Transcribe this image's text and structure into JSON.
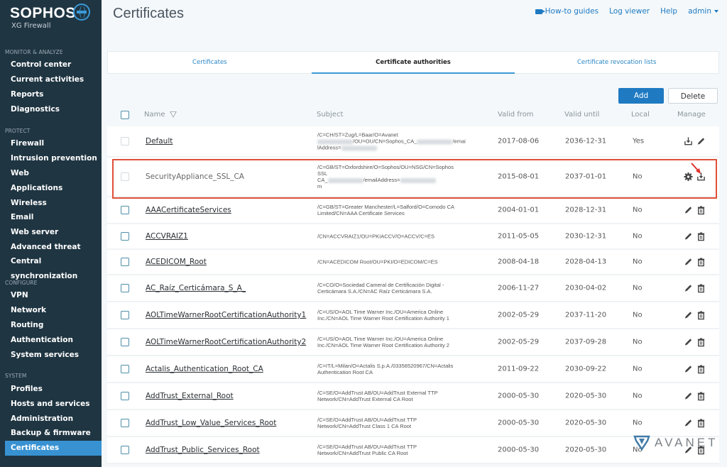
{
  "brand": {
    "name": "SOPHOS",
    "product": "XG Firewall"
  },
  "header": {
    "title": "Certificates"
  },
  "toplinks": {
    "howto": "How-to guides",
    "log": "Log viewer",
    "help": "Help",
    "user": "admin"
  },
  "sidebar": {
    "sections": [
      {
        "label": "MONITOR & ANALYZE",
        "items": [
          "Control center",
          "Current activities",
          "Reports",
          "Diagnostics"
        ]
      },
      {
        "label": "PROTECT",
        "items": [
          "Firewall",
          "Intrusion prevention",
          "Web",
          "Applications",
          "Wireless",
          "Email",
          "Web server",
          "Advanced threat",
          "Central synchronization"
        ]
      },
      {
        "label": "CONFIGURE",
        "items": [
          "VPN",
          "Network",
          "Routing",
          "Authentication",
          "System services"
        ]
      },
      {
        "label": "SYSTEM",
        "items": [
          "Profiles",
          "Hosts and services",
          "Administration",
          "Backup & firmware",
          "Certificates"
        ]
      }
    ],
    "active": "Certificates"
  },
  "tabs": [
    {
      "label": "Certificates",
      "active": false
    },
    {
      "label": "Certificate authorities",
      "active": true
    },
    {
      "label": "Certificate revocation lists",
      "active": false
    }
  ],
  "toolbar": {
    "add_label": "Add",
    "delete_label": "Delete"
  },
  "table": {
    "columns": {
      "name": "Name",
      "subject": "Subject",
      "valid_from": "Valid from",
      "valid_until": "Valid until",
      "local": "Local",
      "manage": "Manage"
    },
    "rows": [
      {
        "name": "Default",
        "subject_lines": [
          "/C=CH/ST=Zug/L=Baar/O=Avanet",
          "[redacted]/OU=OU/CN=Sophos_CA_[redacted]/emai",
          "lAddress=[redacted]"
        ],
        "valid_from": "2017-08-06",
        "valid_until": "2036-12-31",
        "local": "Yes",
        "actions": [
          "download",
          "edit"
        ],
        "link": true,
        "checkbox_enabled": false
      },
      {
        "name": "SecurityAppliance_SSL_CA",
        "subject_lines": [
          "/C=GB/ST=Oxfordshire/O=Sophos/OU=NSG/CN=Sophos",
          "SSL",
          "CA_[redacted]/emailAddress=[redacted]",
          "m"
        ],
        "valid_from": "2015-08-01",
        "valid_until": "2037-01-01",
        "local": "No",
        "actions": [
          "settings",
          "download"
        ],
        "link": false,
        "checkbox_enabled": false,
        "highlighted": true
      },
      {
        "name": "AAACertificateServices",
        "subject_lines": [
          "/C=GB/ST=Greater Manchester/L=Salford/O=Comodo CA",
          "Limited/CN=AAA Certificate Services"
        ],
        "valid_from": "2004-01-01",
        "valid_until": "2028-12-31",
        "local": "No",
        "actions": [
          "edit",
          "delete"
        ],
        "link": true,
        "checkbox_enabled": true
      },
      {
        "name": "ACCVRAIZ1",
        "subject_lines": [
          "/CN=ACCVRAIZ1/OU=PKIACCV/O=ACCV/C=ES"
        ],
        "valid_from": "2011-05-05",
        "valid_until": "2030-12-31",
        "local": "No",
        "actions": [
          "edit",
          "delete"
        ],
        "link": true,
        "checkbox_enabled": true
      },
      {
        "name": "ACEDICOM_Root",
        "subject_lines": [
          "/CN=ACEDICOM Root/OU=PKI/O=EDICOM/C=ES"
        ],
        "valid_from": "2008-04-18",
        "valid_until": "2028-04-13",
        "local": "No",
        "actions": [
          "edit",
          "delete"
        ],
        "link": true,
        "checkbox_enabled": true
      },
      {
        "name": "AC_Raíz_Certicámara_S_A_",
        "subject_lines": [
          "/C=CO/O=Sociedad Cameral de Certificación Digital -",
          "Certicámara S.A./CN=AC Raíz Certicámara S.A."
        ],
        "valid_from": "2006-11-27",
        "valid_until": "2030-04-02",
        "local": "No",
        "actions": [
          "edit",
          "delete"
        ],
        "link": true,
        "checkbox_enabled": true
      },
      {
        "name": "AOLTimeWarnerRootCertificationAuthority1",
        "subject_lines": [
          "/C=US/O=AOL Time Warner Inc./OU=America Online",
          "Inc./CN=AOL Time Warner Root Certification Authority 1"
        ],
        "valid_from": "2002-05-29",
        "valid_until": "2037-11-20",
        "local": "No",
        "actions": [
          "edit",
          "delete"
        ],
        "link": true,
        "checkbox_enabled": true
      },
      {
        "name": "AOLTimeWarnerRootCertificationAuthority2",
        "subject_lines": [
          "/C=US/O=AOL Time Warner Inc./OU=America Online",
          "Inc./CN=AOL Time Warner Root Certification Authority 2"
        ],
        "valid_from": "2002-05-29",
        "valid_until": "2037-09-28",
        "local": "No",
        "actions": [
          "edit",
          "delete"
        ],
        "link": true,
        "checkbox_enabled": true
      },
      {
        "name": "Actalis_Authentication_Root_CA",
        "subject_lines": [
          "/C=IT/L=Milan/O=Actalis S.p.A./03358520967/CN=Actalis",
          "Authentication Root CA"
        ],
        "valid_from": "2011-09-22",
        "valid_until": "2030-09-22",
        "local": "No",
        "actions": [
          "edit",
          "delete"
        ],
        "link": true,
        "checkbox_enabled": true
      },
      {
        "name": "AddTrust_External_Root",
        "subject_lines": [
          "/C=SE/O=AddTrust AB/OU=AddTrust External TTP",
          "Network/CN=AddTrust External CA Root"
        ],
        "valid_from": "2000-05-30",
        "valid_until": "2020-05-30",
        "local": "No",
        "actions": [
          "edit",
          "delete"
        ],
        "link": true,
        "checkbox_enabled": true
      },
      {
        "name": "AddTrust_Low_Value_Services_Root",
        "subject_lines": [
          "/C=SE/O=AddTrust AB/OU=AddTrust TTP",
          "Network/CN=AddTrust Class 1 CA Root"
        ],
        "valid_from": "2000-05-30",
        "valid_until": "2020-05-30",
        "local": "No",
        "actions": [
          "edit",
          "delete"
        ],
        "link": true,
        "checkbox_enabled": true
      },
      {
        "name": "AddTrust_Public_Services_Root",
        "subject_lines": [
          "/C=SE/O=AddTrust AB/OU=AddTrust TTP",
          "Network/CN=AddTrust Public CA Root"
        ],
        "valid_from": "2000-05-30",
        "valid_until": "2020-05-30",
        "local": "No",
        "actions": [
          "edit",
          "delete"
        ],
        "link": true,
        "checkbox_enabled": true
      }
    ]
  },
  "watermark": "AVANET",
  "colors": {
    "sidebar_bg": "#1f3542",
    "accent": "#1f7ac2",
    "active_nav": "#3892d2",
    "highlight": "#e0503a"
  }
}
